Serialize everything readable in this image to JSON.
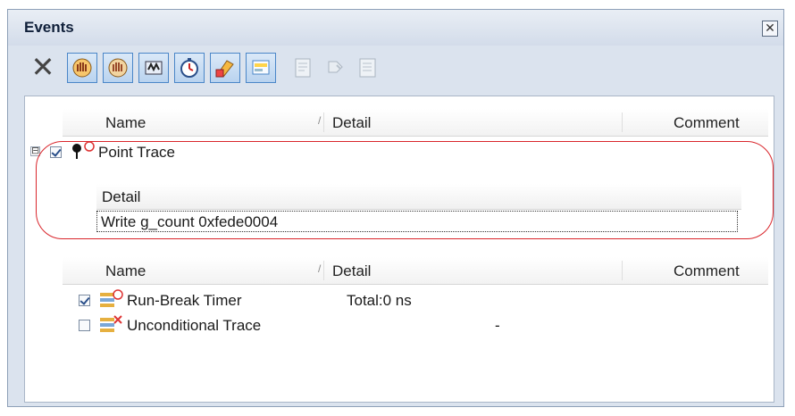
{
  "window": {
    "title": "Events",
    "close_glyph": "✕"
  },
  "toolbar": {
    "delete_glyph": "✕",
    "buttons": [
      {
        "icon": "hardware-break-icon"
      },
      {
        "icon": "software-break-icon"
      },
      {
        "icon": "trace-icon"
      },
      {
        "icon": "timer-icon"
      },
      {
        "icon": "edit-condition-icon"
      },
      {
        "icon": "run-break-icon"
      }
    ],
    "disabled_buttons": [
      {
        "icon": "export-icon"
      },
      {
        "icon": "import-icon"
      },
      {
        "icon": "properties-icon"
      }
    ]
  },
  "list_header": {
    "name": "Name",
    "detail": "Detail",
    "comment": "Comment",
    "sort_glyph": "/"
  },
  "point_trace": {
    "expander": "⊟",
    "checked": true,
    "name": "Point Trace",
    "detail_header": "Detail",
    "detail_value": "Write g_count 0xfede0004"
  },
  "events": [
    {
      "name": "Run-Break Timer",
      "detail": "Total:0 ns",
      "comment": "",
      "checked": true
    },
    {
      "name": "Unconditional Trace",
      "detail": "-",
      "comment": "",
      "checked": false
    }
  ],
  "colors": {
    "highlight": "#d9262c",
    "toolbar_active": "#4a86c8",
    "window_bg": "#dbe3ee"
  }
}
